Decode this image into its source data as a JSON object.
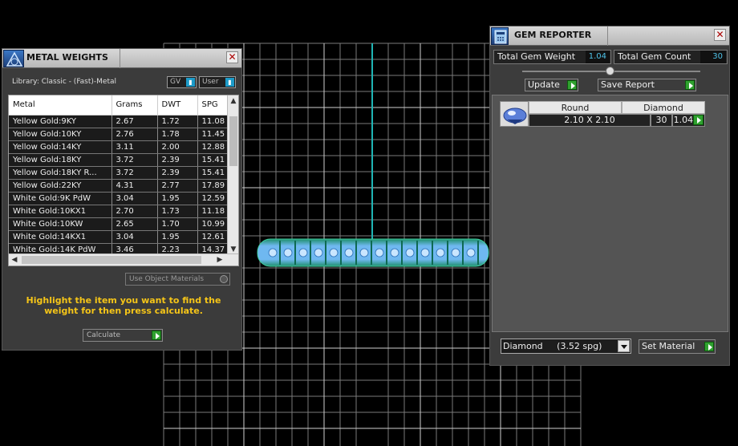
{
  "metal_weights": {
    "title": "METAL WEIGHTS",
    "library_label": "Library: Classic - (Fast)-Metal",
    "gv_option": "GV",
    "user_option": "User",
    "columns": [
      "Metal",
      "Grams",
      "DWT",
      "SPG"
    ],
    "rows": [
      [
        "Yellow Gold:9KY",
        "2.67",
        "1.72",
        "11.08"
      ],
      [
        "Yellow Gold:10KY",
        "2.76",
        "1.78",
        "11.45"
      ],
      [
        "Yellow Gold:14KY",
        "3.11",
        "2.00",
        "12.88"
      ],
      [
        "Yellow Gold:18KY",
        "3.72",
        "2.39",
        "15.41"
      ],
      [
        "Yellow Gold:18KY R...",
        "3.72",
        "2.39",
        "15.41"
      ],
      [
        "Yellow Gold:22KY",
        "4.31",
        "2.77",
        "17.89"
      ],
      [
        "White Gold:9K PdW",
        "3.04",
        "1.95",
        "12.59"
      ],
      [
        "White Gold:10KX1",
        "2.70",
        "1.73",
        "11.18"
      ],
      [
        "White Gold:10KW",
        "2.65",
        "1.70",
        "10.99"
      ],
      [
        "White Gold:14KX1",
        "3.04",
        "1.95",
        "12.61"
      ],
      [
        "White Gold:14K PdW",
        "3.46",
        "2.23",
        "14.37"
      ]
    ],
    "use_object_materials": "Use Object Materials",
    "hint": "Highlight the item you want to find the weight for then press calculate.",
    "calculate_label": "Calculate"
  },
  "gem_reporter": {
    "title": "GEM REPORTER",
    "total_gem_weight_label": "Total Gem Weight",
    "total_gem_weight_value": "1.04",
    "total_gem_count_label": "Total Gem Count",
    "total_gem_count_value": "30",
    "update_label": "Update",
    "save_report_label": "Save Report",
    "gem_rows": [
      {
        "shape": "Round",
        "material": "Diamond",
        "size": "2.10 X 2.10",
        "count": "30",
        "weight": "1.04tw"
      }
    ],
    "material_select": "Diamond     (3.52 spg)",
    "set_material_label": "Set Material"
  },
  "colors": {
    "accent_green": "#2fa12f",
    "hint_yellow": "#f5c518",
    "value_cyan": "#4ec2e8",
    "ring_cyan": "#6fb8f0",
    "ring_green": "#1e8f6a"
  }
}
